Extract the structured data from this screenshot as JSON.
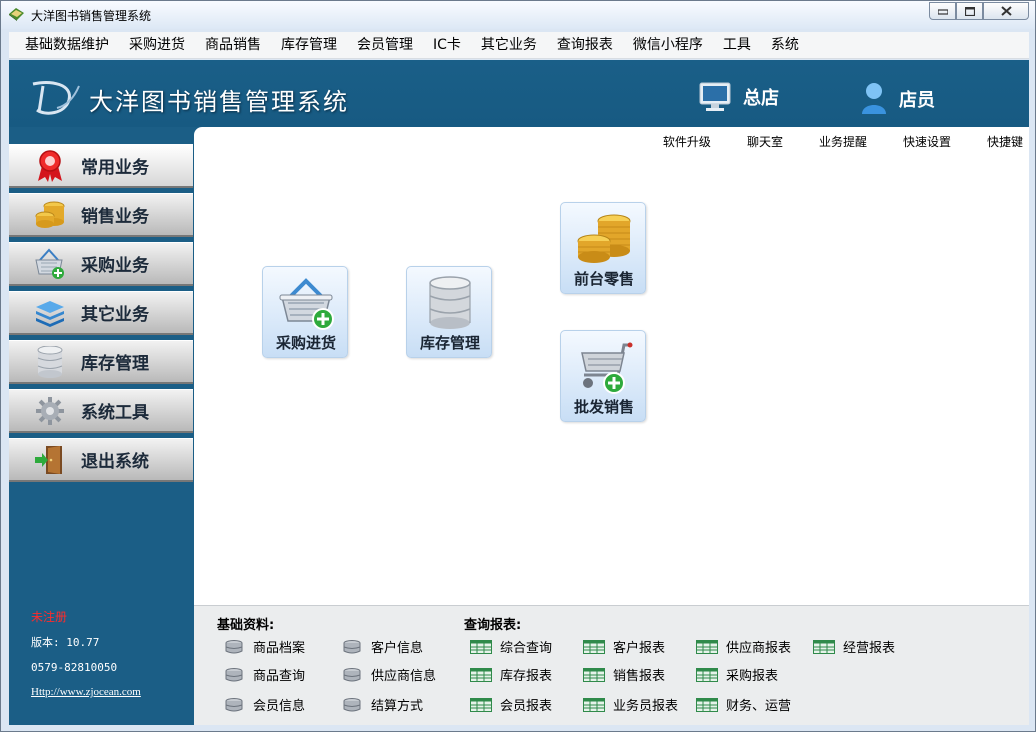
{
  "window": {
    "title": "大洋图书销售管理系统",
    "min_label": "▭",
    "max_label": "◻",
    "close_label": "✕"
  },
  "menu": [
    "基础数据维护",
    "采购进货",
    "商品销售",
    "库存管理",
    "会员管理",
    "IC卡",
    "其它业务",
    "查询报表",
    "微信小程序",
    "工具",
    "系统"
  ],
  "header": {
    "title": "大洋图书销售管理系统",
    "store_label": "总店",
    "user_label": "店员",
    "logo_icon": "d-logo-icon"
  },
  "sidebar": {
    "items": [
      {
        "label": "常用业务",
        "icon": "ribbon-icon"
      },
      {
        "label": "销售业务",
        "icon": "coins-icon"
      },
      {
        "label": "采购业务",
        "icon": "basket-icon"
      },
      {
        "label": "其它业务",
        "icon": "layers-icon"
      },
      {
        "label": "库存管理",
        "icon": "database-icon"
      },
      {
        "label": "系统工具",
        "icon": "gear-icon"
      },
      {
        "label": "退出系统",
        "icon": "exit-door-icon"
      }
    ],
    "info": {
      "registration": "未注册",
      "version": "版本: 10.77",
      "phone": "0579-82810050",
      "url": "Http://www.zjocean.com"
    }
  },
  "toplinks": [
    "软件升级",
    "聊天室",
    "业务提醒",
    "快速设置",
    "快捷键"
  ],
  "tiles": {
    "purchase": "采购进货",
    "inventory": "库存管理",
    "retail": "前台零售",
    "wholesale": "批发销售"
  },
  "bottom": {
    "basic_title": "基础资料:",
    "basic_links": [
      "商品档案",
      "客户信息",
      "商品查询",
      "供应商信息",
      "会员信息",
      "结算方式"
    ],
    "report_title": "查询报表:",
    "report_links": [
      "综合查询",
      "客户报表",
      "供应商报表",
      "经营报表",
      "库存报表",
      "销售报表",
      "采购报表",
      "会员报表",
      "业务员报表",
      "财务、运营"
    ]
  },
  "colors": {
    "header_blue": "#1b5e86",
    "sidebar_gray": "#c4c4c4",
    "tile_blue": "#c8def5",
    "register_red": "#ff2b2b"
  }
}
